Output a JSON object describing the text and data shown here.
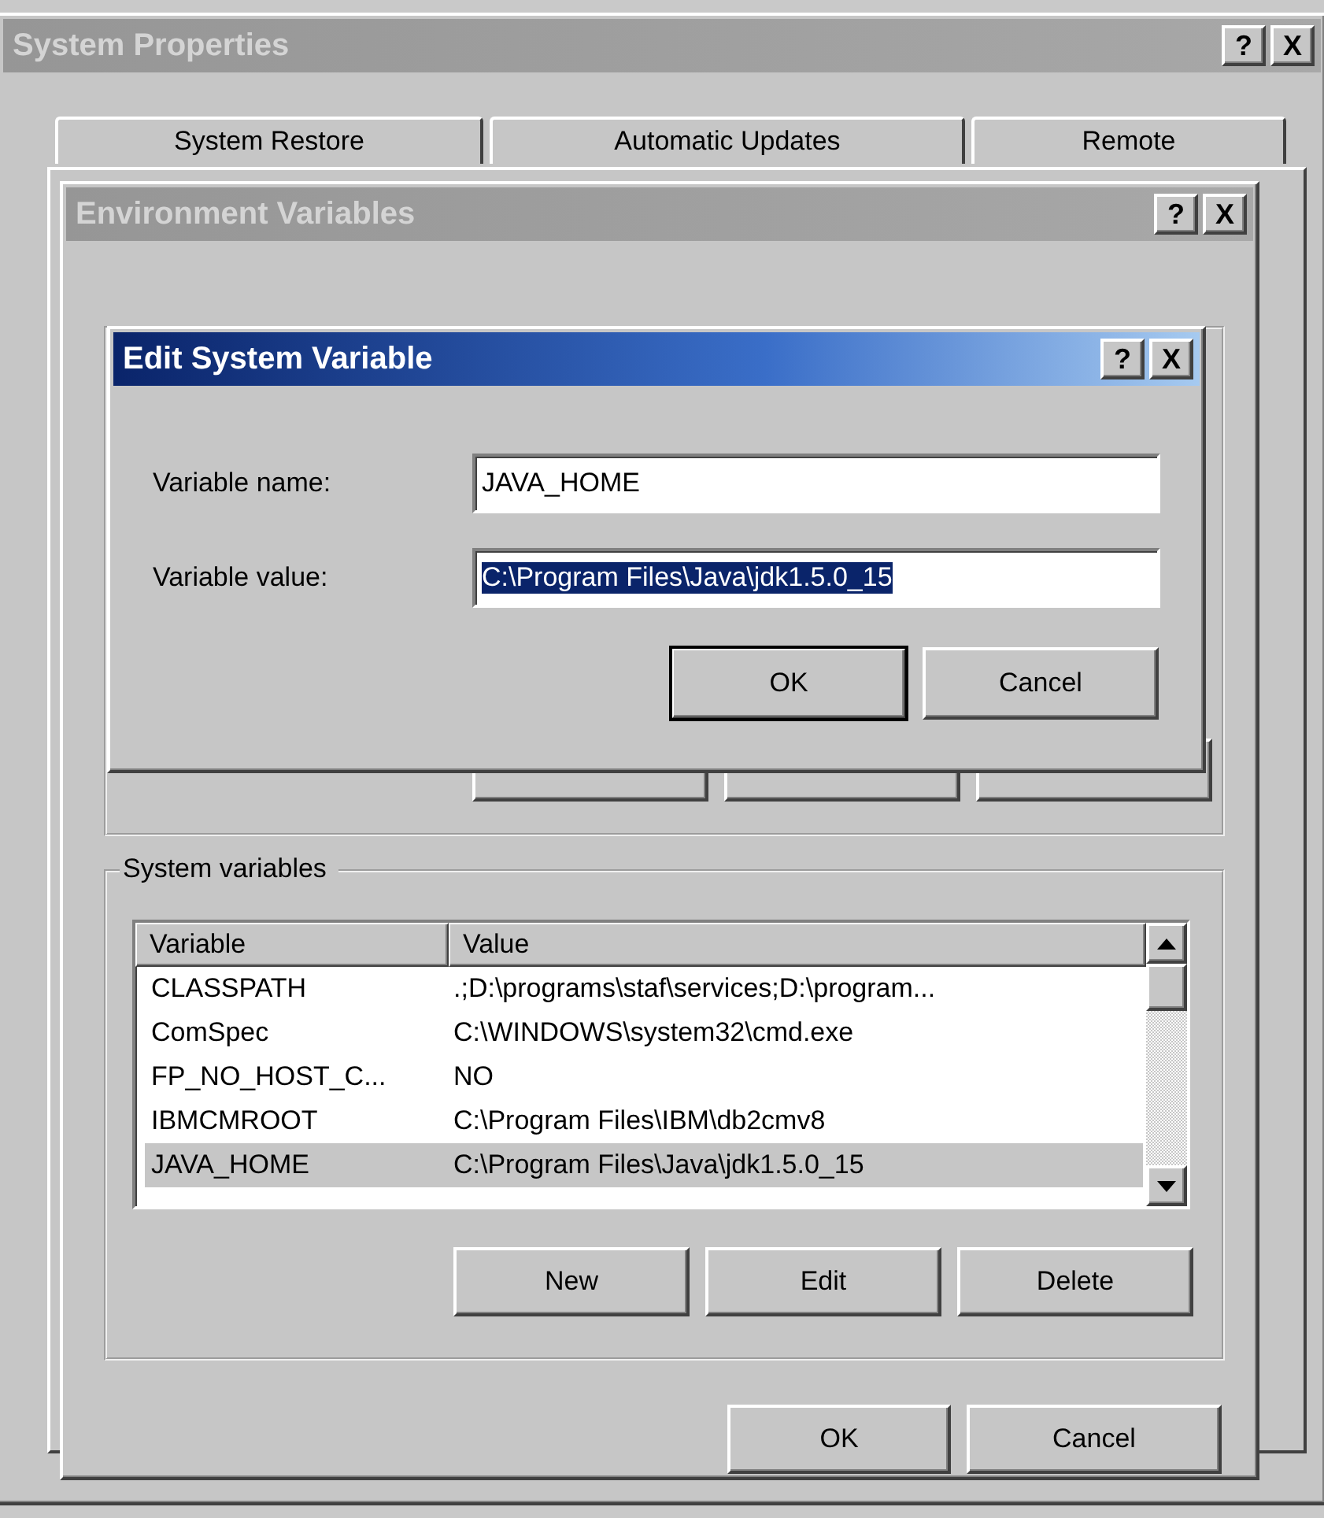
{
  "system_properties": {
    "title": "System Properties",
    "active": false,
    "title_buttons": [
      "?",
      "X"
    ],
    "tabs": [
      {
        "label": "System Restore",
        "selected": false
      },
      {
        "label": "Automatic Updates",
        "selected": false
      },
      {
        "label": "Remote",
        "selected": false
      }
    ]
  },
  "environment_variables": {
    "title": "Environment Variables",
    "active": false,
    "title_buttons": [
      "?",
      "X"
    ],
    "system_variables": {
      "title": "System variables",
      "columns": [
        "Variable",
        "Value"
      ],
      "rows": [
        {
          "variable": "CLASSPATH",
          "value": ".;D:\\programs\\staf\\services;D:\\program...",
          "selected": false
        },
        {
          "variable": "ComSpec",
          "value": "C:\\WINDOWS\\system32\\cmd.exe",
          "selected": false
        },
        {
          "variable": "FP_NO_HOST_C...",
          "value": "NO",
          "selected": false
        },
        {
          "variable": "IBMCMROOT",
          "value": "C:\\Program Files\\IBM\\db2cmv8",
          "selected": false
        },
        {
          "variable": "JAVA_HOME",
          "value": "C:\\Program Files\\Java\\jdk1.5.0_15",
          "selected": true
        }
      ],
      "buttons": [
        "New",
        "Edit",
        "Delete"
      ]
    },
    "buttons": [
      {
        "label": "OK",
        "default": false
      },
      {
        "label": "Cancel",
        "default": false
      }
    ]
  },
  "edit_dialog": {
    "title": "Edit System Variable",
    "active": true,
    "title_buttons": [
      "?",
      "X"
    ],
    "fields": [
      {
        "label": "Variable name:",
        "value": "JAVA_HOME",
        "selected": false
      },
      {
        "label": "Variable value:",
        "value": "C:\\Program Files\\Java\\jdk1.5.0_15",
        "selected": true
      }
    ],
    "buttons": [
      {
        "label": "OK",
        "default": true
      },
      {
        "label": "Cancel",
        "default": false
      }
    ]
  }
}
